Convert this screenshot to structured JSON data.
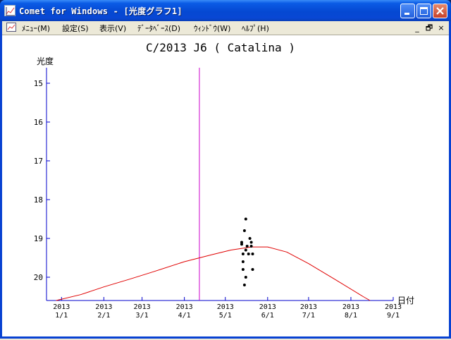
{
  "window": {
    "title": "Comet for Windows - [光度グラフ1]",
    "controls": [
      "minimize",
      "maximize",
      "close"
    ]
  },
  "menubar": {
    "items": [
      {
        "label": "ﾒﾆｭｰ(M)"
      },
      {
        "label": "設定(S)"
      },
      {
        "label": "表示(V)"
      },
      {
        "label": "ﾃﾞｰﾀﾍﾞｰｽ(D)"
      },
      {
        "label": "ｳｨﾝﾄﾞｳ(W)"
      },
      {
        "label": "ﾍﾙﾌﾟ(H)"
      }
    ],
    "mdi_controls": [
      "_",
      "🗗",
      "×"
    ]
  },
  "chart_data": {
    "type": "scatter",
    "title": "C/2013 J6 ( Catalina )",
    "ylabel": "光度",
    "xlabel": "日付",
    "y_inverted": true,
    "ylim": [
      20.6,
      14.6
    ],
    "xlim": [
      "2012-12-21",
      "2013-09-01"
    ],
    "y_ticks": [
      15,
      16,
      17,
      18,
      19,
      20
    ],
    "x_ticks": [
      {
        "date": "2013-01-01",
        "year": "2013",
        "md": "1/1"
      },
      {
        "date": "2013-02-01",
        "year": "2013",
        "md": "2/1"
      },
      {
        "date": "2013-03-01",
        "year": "2013",
        "md": "3/1"
      },
      {
        "date": "2013-04-01",
        "year": "2013",
        "md": "4/1"
      },
      {
        "date": "2013-05-01",
        "year": "2013",
        "md": "5/1"
      },
      {
        "date": "2013-06-01",
        "year": "2013",
        "md": "6/1"
      },
      {
        "date": "2013-07-01",
        "year": "2013",
        "md": "7/1"
      },
      {
        "date": "2013-08-01",
        "year": "2013",
        "md": "8/1"
      },
      {
        "date": "2013-09-01",
        "year": "2013",
        "md": "9/1"
      }
    ],
    "current_date_marker": "2013-04-12",
    "series": [
      {
        "kind": "predicted_curve",
        "color": "#e00000",
        "points": [
          [
            "2012-12-28",
            20.6
          ],
          [
            "2013-01-15",
            20.45
          ],
          [
            "2013-02-01",
            20.25
          ],
          [
            "2013-02-20",
            20.05
          ],
          [
            "2013-03-10",
            19.85
          ],
          [
            "2013-04-01",
            19.6
          ],
          [
            "2013-04-20",
            19.43
          ],
          [
            "2013-05-05",
            19.3
          ],
          [
            "2013-05-20",
            19.22
          ],
          [
            "2013-06-01",
            19.22
          ],
          [
            "2013-06-15",
            19.35
          ],
          [
            "2013-07-01",
            19.65
          ],
          [
            "2013-07-20",
            20.05
          ],
          [
            "2013-08-10",
            20.5
          ],
          [
            "2013-08-15",
            20.6
          ]
        ]
      },
      {
        "kind": "observations",
        "color": "#000000",
        "points": [
          [
            "2013-05-13",
            19.15
          ],
          [
            "2013-05-13",
            19.1
          ],
          [
            "2013-05-14",
            19.4
          ],
          [
            "2013-05-14",
            19.6
          ],
          [
            "2013-05-14",
            19.8
          ],
          [
            "2013-05-15",
            20.2
          ],
          [
            "2013-05-15",
            18.8
          ],
          [
            "2013-05-16",
            18.5
          ],
          [
            "2013-05-16",
            19.3
          ],
          [
            "2013-05-16",
            20.0
          ],
          [
            "2013-05-17",
            19.2
          ],
          [
            "2013-05-18",
            19.4
          ],
          [
            "2013-05-19",
            19.0
          ],
          [
            "2013-05-20",
            19.1
          ],
          [
            "2013-05-20",
            19.2
          ],
          [
            "2013-05-21",
            19.4
          ],
          [
            "2013-05-21",
            19.8
          ]
        ]
      }
    ]
  }
}
